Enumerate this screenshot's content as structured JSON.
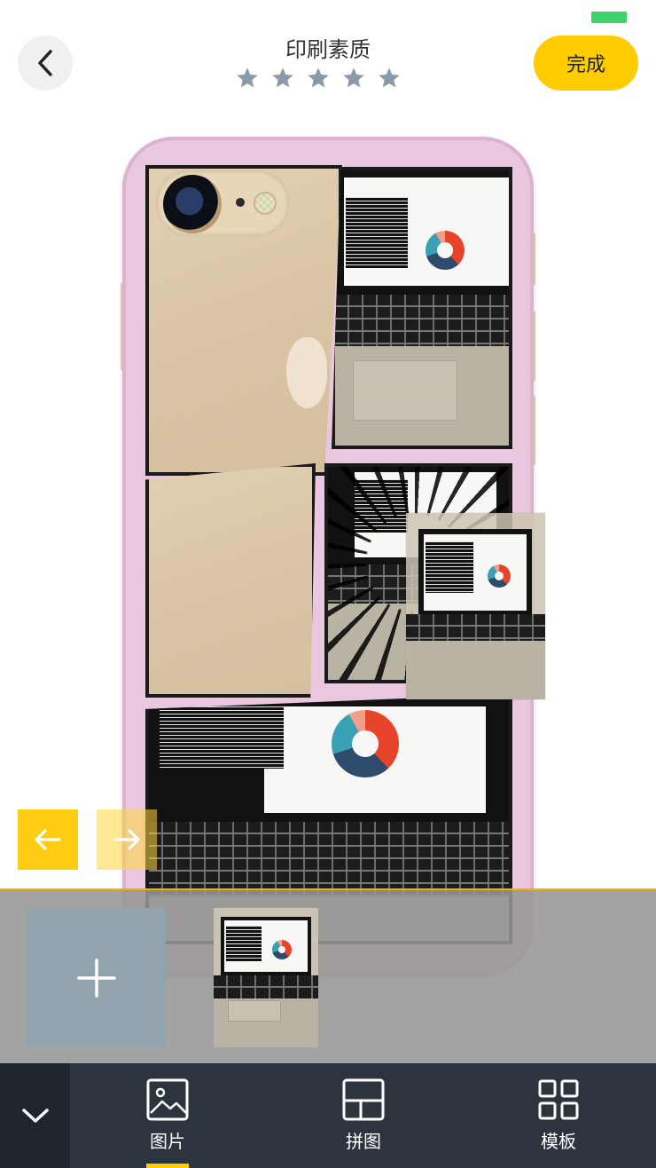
{
  "header": {
    "title": "印刷素质",
    "rating": 5,
    "done_label": "完成"
  },
  "colors": {
    "accent": "#ffcc00",
    "case": "#e9c8df",
    "tray": "#969696",
    "bottom_bar": "#2c343e"
  },
  "tabs": [
    {
      "label": "图片",
      "icon": "image-icon",
      "active": true
    },
    {
      "label": "拼图",
      "icon": "collage-layout-icon",
      "active": false
    },
    {
      "label": "模板",
      "icon": "template-grid-icon",
      "active": false
    }
  ]
}
